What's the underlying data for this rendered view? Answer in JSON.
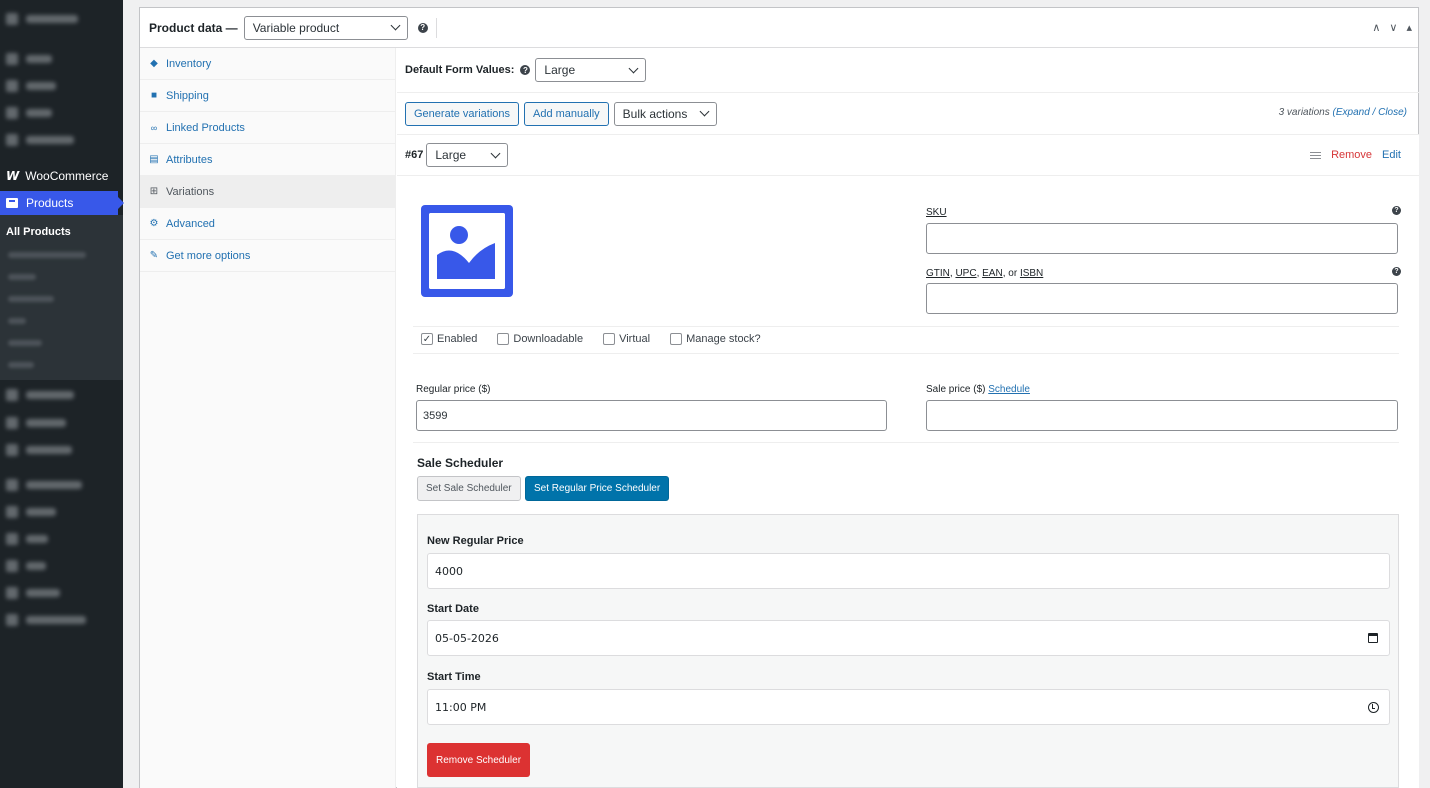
{
  "sidebar": {
    "woocommerce_label": "WooCommerce",
    "woocommerce_logo": "W",
    "products_label": "Products",
    "all_products_label": "All Products"
  },
  "header": {
    "title": "Product data —",
    "product_type": "Variable product",
    "help": "?",
    "controls": [
      "∧",
      "∨",
      "▴"
    ]
  },
  "tabs": [
    {
      "label": "Inventory",
      "icon": "◆"
    },
    {
      "label": "Shipping",
      "icon": "■"
    },
    {
      "label": "Linked Products",
      "icon": "🔗"
    },
    {
      "label": "Attributes",
      "icon": "▤"
    },
    {
      "label": "Variations",
      "icon": "⊞"
    },
    {
      "label": "Advanced",
      "icon": "⚙"
    },
    {
      "label": "Get more options",
      "icon": "✎"
    }
  ],
  "defaults": {
    "label": "Default Form Values:",
    "value": "Large"
  },
  "actions": {
    "generate": "Generate variations",
    "add": "Add manually",
    "bulk": "Bulk actions",
    "count": "3 variations",
    "expand": "(Expand / Close)"
  },
  "variation": {
    "id": "#67",
    "size": "Large",
    "remove": "Remove",
    "edit": "Edit"
  },
  "fields": {
    "sku_label": "SKU",
    "gtin_label_1": "GTIN",
    "gtin_label_2": "UPC",
    "gtin_label_3": "EAN",
    "gtin_label_or": ", or ",
    "gtin_label_4": "ISBN",
    "enabled": "Enabled",
    "downloadable": "Downloadable",
    "virtual": "Virtual",
    "manage_stock": "Manage stock?",
    "regular_price_label": "Regular price ($)",
    "regular_price": "3599",
    "sale_price_label": "Sale price ($)",
    "schedule": "Schedule"
  },
  "scheduler": {
    "title": "Sale Scheduler",
    "set_sale": "Set Sale Scheduler",
    "set_regular": "Set Regular Price Scheduler",
    "new_price_label": "New Regular Price",
    "new_price": "4000",
    "start_date_label": "Start Date",
    "start_date": "05-05-2026",
    "start_time_label": "Start Time",
    "start_time": "11:00 PM",
    "remove": "Remove Scheduler"
  },
  "colors": {
    "accent": "#3858e9",
    "link": "#2271b1",
    "danger": "#dc3232",
    "primary_button": "#0073aa"
  }
}
